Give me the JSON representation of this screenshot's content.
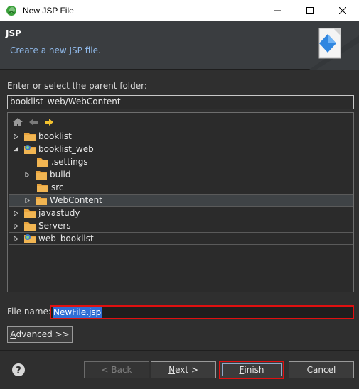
{
  "window": {
    "title": "New JSP File",
    "buttons": [
      "minimize",
      "maximize",
      "close"
    ]
  },
  "banner": {
    "heading": "JSP",
    "description": "Create a new JSP file."
  },
  "parent_folder": {
    "label": "Enter or select the parent folder:",
    "value": "booklist_web/WebContent"
  },
  "tree": {
    "toolbar_icons": [
      "home-icon",
      "back-icon",
      "forward-icon"
    ],
    "nodes": [
      {
        "label": "booklist",
        "twisty": "collapsed",
        "icon": "project-folder-icon"
      },
      {
        "label": "booklist_web",
        "twisty": "expanded",
        "icon": "web-project-icon"
      },
      {
        "label": ".settings",
        "twisty": "none",
        "icon": "folder-icon"
      },
      {
        "label": "build",
        "twisty": "collapsed",
        "icon": "folder-icon"
      },
      {
        "label": "src",
        "twisty": "none",
        "icon": "folder-icon"
      },
      {
        "label": "WebContent",
        "twisty": "collapsed",
        "icon": "folder-icon",
        "selected": true
      },
      {
        "label": "javastudy",
        "twisty": "collapsed",
        "icon": "project-folder-icon"
      },
      {
        "label": "Servers",
        "twisty": "collapsed",
        "icon": "folder-icon"
      },
      {
        "label": "web_booklist",
        "twisty": "collapsed",
        "icon": "web-project-icon"
      }
    ]
  },
  "file_name": {
    "label": "File name:",
    "value": "NewFile.jsp"
  },
  "advanced": {
    "label_first": "A",
    "label_rest": "dvanced >>"
  },
  "footer": {
    "back_label": "< Back",
    "next_label_first": "N",
    "next_label_rest": "ext >",
    "finish_label_first": "F",
    "finish_label_rest": "inish",
    "cancel_label": "Cancel"
  },
  "colors": {
    "accent_highlight": "#e01010",
    "selection": "#2f6fd6",
    "description_text": "#8fb8e8",
    "folder": "#e8a33d"
  }
}
